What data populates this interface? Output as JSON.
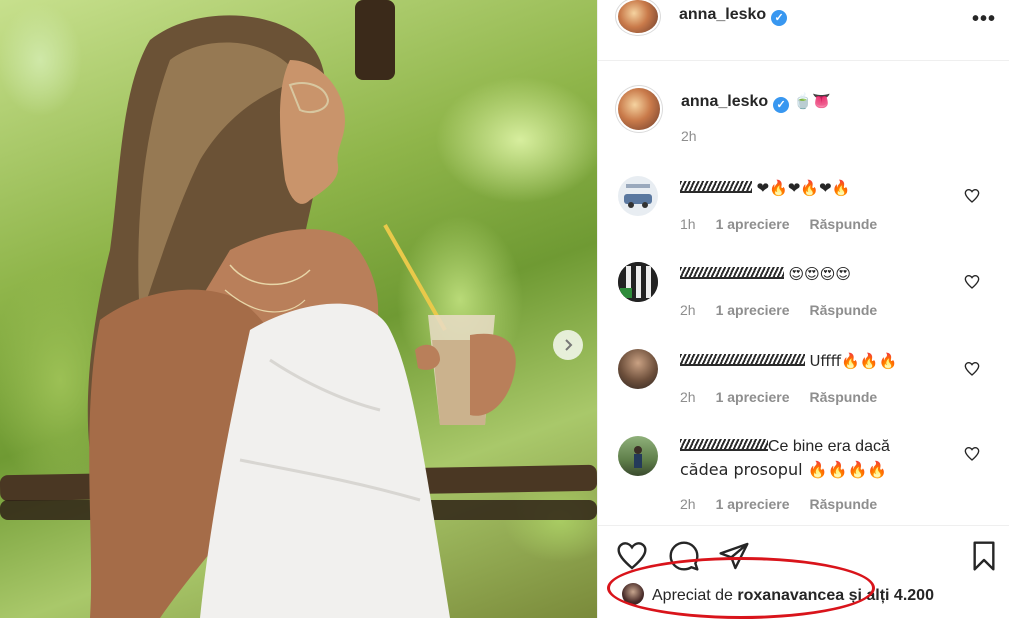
{
  "post": {
    "author": "anna_lesko",
    "caption_emojis": "🍵👅",
    "caption_time": "2h",
    "more_icon": "more-horizontal-icon"
  },
  "comments": [
    {
      "name": "bunucsss",
      "text": "❤🔥❤🔥❤🔥",
      "time": "1h",
      "likes": "1 apreciere",
      "reply": "Răspunde"
    },
    {
      "name": "mircea_rosca",
      "text": "😍😍😍😍",
      "time": "2h",
      "likes": "1 apreciere",
      "reply": "Răspunde"
    },
    {
      "name": "olimpiu_marius",
      "text": "Uffff🔥🔥🔥",
      "time": "2h",
      "likes": "1 apreciere",
      "reply": "Răspunde"
    },
    {
      "name": "dragos2028",
      "text_line1": "Ce bine era dacă",
      "text_line2": "cădea prosopul 🔥🔥🔥🔥",
      "time": "2h",
      "likes": "1 apreciere",
      "reply": "Răspunde"
    }
  ],
  "likes": {
    "prefix": "Apreciat de",
    "user": "roxanavancea",
    "suffix": "și alți 4.200"
  },
  "colors": {
    "verified": "#3897f0",
    "annotation": "#d9141b",
    "meta": "#8e8e8e"
  }
}
